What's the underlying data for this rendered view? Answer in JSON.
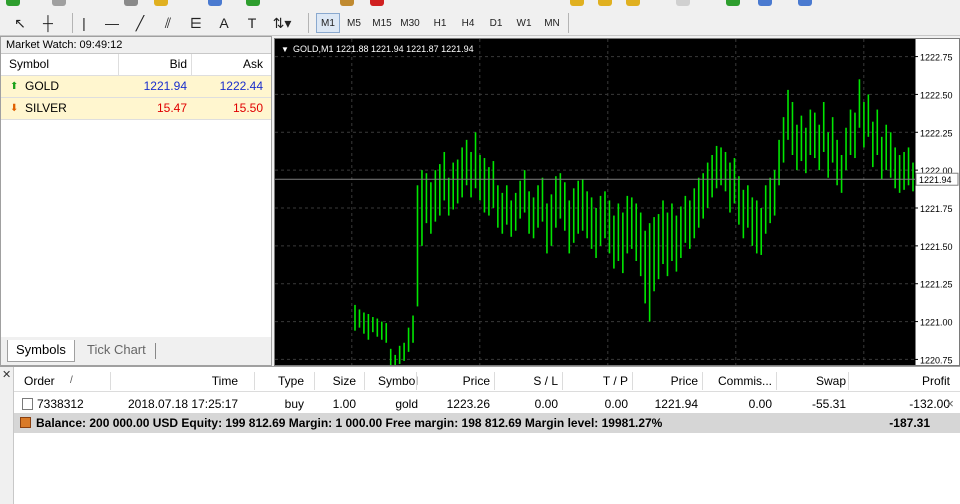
{
  "toolbar": {
    "tools": [
      {
        "name": "cursor-icon",
        "glyph": "↖"
      },
      {
        "name": "crosshair-icon",
        "glyph": "┼"
      },
      {
        "name": "vertical-line-icon",
        "glyph": "|"
      },
      {
        "name": "horizontal-line-icon",
        "glyph": "—"
      },
      {
        "name": "trendline-icon",
        "glyph": "╱"
      },
      {
        "name": "equidistant-channel-icon",
        "glyph": "⫽"
      },
      {
        "name": "fibonacci-icon",
        "glyph": "⋿"
      },
      {
        "name": "text-icon",
        "glyph": "A"
      },
      {
        "name": "text-label-icon",
        "glyph": "T"
      },
      {
        "name": "arrows-dropdown-icon",
        "glyph": "⇅▾"
      }
    ],
    "timeframes": [
      "M1",
      "M5",
      "M15",
      "M30",
      "H1",
      "H4",
      "D1",
      "W1",
      "MN"
    ],
    "active_timeframe": "M1"
  },
  "market_watch": {
    "title": "Market Watch: 09:49:12",
    "columns": [
      "Symbol",
      "Bid",
      "Ask"
    ],
    "rows": [
      {
        "symbol": "GOLD",
        "bid": "1221.94",
        "ask": "1222.44",
        "direction": "up",
        "color": "#1a2ecc",
        "arrow_color": "#1aa11a"
      },
      {
        "symbol": "SILVER",
        "bid": "15.47",
        "ask": "15.50",
        "direction": "down",
        "color": "#e00000",
        "arrow_color": "#e06000"
      }
    ],
    "tabs": [
      "Symbols",
      "Tick Chart"
    ],
    "active_tab": "Symbols"
  },
  "chart": {
    "header": "GOLD,M1  1221.88 1221.94 1221.87 1221.94",
    "current_price_label": "1221.94",
    "colors": {
      "bars": "#00e600",
      "grid": "#3a3a3a",
      "axis_text": "#000000",
      "background": "#000000"
    }
  },
  "chart_data": {
    "type": "ohlc",
    "symbol": "GOLD",
    "timeframe": "M1",
    "ylim": [
      1220.7,
      1222.8
    ],
    "y_ticks": [
      "1222.75",
      "1222.50",
      "1222.25",
      "1222.00",
      "1221.75",
      "1221.50",
      "1221.25",
      "1221.00",
      "1220.75"
    ],
    "last_price": 1221.94,
    "grid": true,
    "bars_high": [
      1221.11,
      1221.08,
      1221.06,
      1221.05,
      1221.03,
      1221.02,
      1221.0,
      1220.99,
      1220.82,
      1220.78,
      1220.84,
      1220.86,
      1220.96,
      1221.04,
      1221.9,
      1222.0,
      1221.98,
      1221.92,
      1222.0,
      1222.04,
      1222.12,
      1221.95,
      1222.05,
      1222.07,
      1222.15,
      1222.2,
      1222.12,
      1222.25,
      1222.1,
      1222.08,
      1222.02,
      1222.06,
      1221.9,
      1221.85,
      1221.9,
      1221.8,
      1221.85,
      1221.93,
      1222.0,
      1221.86,
      1221.82,
      1221.9,
      1221.95,
      1221.78,
      1221.84,
      1221.96,
      1221.98,
      1221.92,
      1221.8,
      1221.88,
      1221.93,
      1221.94,
      1221.86,
      1221.82,
      1221.75,
      1221.83,
      1221.86,
      1221.8,
      1221.7,
      1221.78,
      1221.72,
      1221.83,
      1221.82,
      1221.78,
      1221.72,
      1221.6,
      1221.65,
      1221.69,
      1221.71,
      1221.8,
      1221.72,
      1221.78,
      1221.7,
      1221.76,
      1221.83,
      1221.8,
      1221.88,
      1221.95,
      1221.98,
      1222.05,
      1222.1,
      1222.16,
      1222.15,
      1222.12,
      1222.05,
      1222.08,
      1221.96,
      1221.87,
      1221.9,
      1221.82,
      1221.8,
      1221.75,
      1221.9,
      1221.95,
      1222.0,
      1222.2,
      1222.35,
      1222.53,
      1222.45,
      1222.3,
      1222.36,
      1222.28,
      1222.4,
      1222.38,
      1222.3,
      1222.45,
      1222.25,
      1222.35,
      1222.2,
      1222.1,
      1222.28,
      1222.4,
      1222.38,
      1222.6,
      1222.45,
      1222.5,
      1222.32,
      1222.4,
      1222.22,
      1222.3,
      1222.25,
      1222.15,
      1222.1,
      1222.12,
      1222.15,
      1222.05
    ],
    "bars_low": [
      1220.94,
      1220.96,
      1220.92,
      1220.88,
      1220.93,
      1220.9,
      1220.88,
      1220.86,
      1220.7,
      1220.7,
      1220.72,
      1220.74,
      1220.8,
      1220.86,
      1221.1,
      1221.5,
      1221.65,
      1221.58,
      1221.66,
      1221.7,
      1221.8,
      1221.7,
      1221.74,
      1221.78,
      1221.82,
      1221.9,
      1221.82,
      1221.88,
      1221.8,
      1221.72,
      1221.7,
      1221.75,
      1221.62,
      1221.58,
      1221.64,
      1221.56,
      1221.6,
      1221.68,
      1221.72,
      1221.58,
      1221.55,
      1221.62,
      1221.66,
      1221.45,
      1221.5,
      1221.62,
      1221.68,
      1221.6,
      1221.45,
      1221.52,
      1221.58,
      1221.6,
      1221.55,
      1221.48,
      1221.42,
      1221.5,
      1221.55,
      1221.45,
      1221.35,
      1221.4,
      1221.32,
      1221.45,
      1221.48,
      1221.4,
      1221.3,
      1221.12,
      1221.0,
      1221.2,
      1221.28,
      1221.38,
      1221.3,
      1221.4,
      1221.33,
      1221.42,
      1221.52,
      1221.48,
      1221.55,
      1221.62,
      1221.68,
      1221.75,
      1221.82,
      1221.88,
      1221.9,
      1221.86,
      1221.72,
      1221.78,
      1221.64,
      1221.55,
      1221.62,
      1221.5,
      1221.45,
      1221.44,
      1221.58,
      1221.65,
      1221.7,
      1221.9,
      1222.05,
      1222.2,
      1222.1,
      1222.0,
      1222.06,
      1221.98,
      1222.1,
      1222.08,
      1222.0,
      1222.12,
      1221.95,
      1222.05,
      1221.9,
      1221.85,
      1222.0,
      1222.1,
      1222.08,
      1222.28,
      1222.15,
      1222.22,
      1222.02,
      1222.1,
      1221.94,
      1222.0,
      1221.95,
      1221.88,
      1221.85,
      1221.87,
      1221.9,
      1221.86
    ]
  },
  "terminal": {
    "columns": [
      "Order",
      "Time",
      "Type",
      "Size",
      "Symbol",
      "Price",
      "S / L",
      "T / P",
      "Price",
      "Commis...",
      "Swap",
      "Profit"
    ],
    "sort_marker": "/",
    "orders": [
      {
        "order": "7338312",
        "time": "2018.07.18 17:25:17",
        "type": "buy",
        "size": "1.00",
        "symbol": "gold",
        "price": "1223.26",
        "sl": "0.00",
        "tp": "0.00",
        "current_price": "1221.94",
        "commission": "0.00",
        "swap": "-55.31",
        "profit": "-132.00",
        "close_glyph": "×"
      }
    ],
    "balance": {
      "text": "Balance: 200 000.00 USD  Equity: 199 812.69  Margin: 1 000.00  Free margin: 198 812.69  Margin level: 19981.27%",
      "profit": "-187.31"
    }
  }
}
